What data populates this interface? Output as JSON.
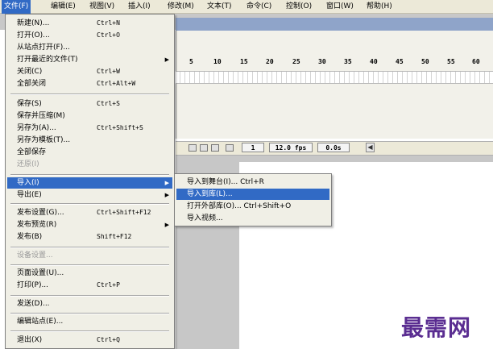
{
  "menubar": {
    "items": [
      {
        "label": "文件(F)",
        "active": true
      },
      {
        "label": "编辑(E)"
      },
      {
        "label": "视图(V)"
      },
      {
        "label": "插入(I)"
      },
      {
        "label": "修改(M)"
      },
      {
        "label": "文本(T)"
      },
      {
        "label": "命令(C)"
      },
      {
        "label": "控制(O)"
      },
      {
        "label": "窗口(W)"
      },
      {
        "label": "帮助(H)"
      }
    ]
  },
  "file_menu": {
    "items": [
      {
        "label": "新建(N)...",
        "shortcut": "Ctrl+N"
      },
      {
        "label": "打开(O)...",
        "shortcut": "Ctrl+O"
      },
      {
        "label": "从站点打开(F)...",
        "shortcut": ""
      },
      {
        "label": "打开最近的文件(T)",
        "shortcut": "",
        "submenu": true
      },
      {
        "label": "关闭(C)",
        "shortcut": "Ctrl+W"
      },
      {
        "label": "全部关闭",
        "shortcut": "Ctrl+Alt+W"
      },
      {
        "label": "保存(S)",
        "shortcut": "Ctrl+S"
      },
      {
        "label": "保存并压缩(M)",
        "shortcut": ""
      },
      {
        "label": "另存为(A)...",
        "shortcut": "Ctrl+Shift+S"
      },
      {
        "label": "另存为模板(T)...",
        "shortcut": ""
      },
      {
        "label": "全部保存",
        "shortcut": ""
      },
      {
        "label": "还原(I)",
        "shortcut": "",
        "disabled": true
      },
      {
        "label": "导入(I)",
        "shortcut": "",
        "submenu": true,
        "highlighted": true
      },
      {
        "label": "导出(E)",
        "shortcut": "",
        "submenu": true
      },
      {
        "label": "发布设置(G)...",
        "shortcut": "Ctrl+Shift+F12"
      },
      {
        "label": "发布预览(R)",
        "shortcut": "",
        "submenu": true
      },
      {
        "label": "发布(B)",
        "shortcut": "Shift+F12"
      },
      {
        "label": "设备设置...",
        "shortcut": "",
        "disabled": true
      },
      {
        "label": "页面设置(U)...",
        "shortcut": ""
      },
      {
        "label": "打印(P)...",
        "shortcut": "Ctrl+P"
      },
      {
        "label": "发送(D)...",
        "shortcut": ""
      },
      {
        "label": "编辑站点(E)...",
        "shortcut": ""
      },
      {
        "label": "退出(X)",
        "shortcut": "Ctrl+Q"
      }
    ],
    "submenu_arrow": "▶"
  },
  "import_submenu": {
    "items": [
      {
        "label": "导入到舞台(I)... Ctrl+R"
      },
      {
        "label": "导入到库(L)...",
        "highlighted": true
      },
      {
        "label": "打开外部库(O)... Ctrl+Shift+O"
      },
      {
        "label": "导入视频..."
      }
    ]
  },
  "timeline": {
    "ruler_numbers": [
      "5",
      "10",
      "15",
      "20",
      "25",
      "30",
      "35",
      "40",
      "45",
      "50",
      "55",
      "60"
    ],
    "current_frame": "1",
    "frame_rate": "12.0 fps",
    "elapsed_time": "0.0s"
  },
  "watermark": "最需网",
  "colors": {
    "menu_highlight": "#316ac5",
    "menu_background": "#f0efe6",
    "menubar_background": "#ece9d8",
    "watermark": "#5a2d91"
  }
}
